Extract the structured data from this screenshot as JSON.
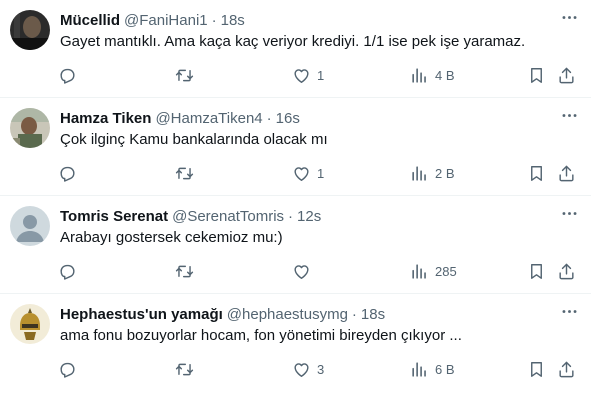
{
  "tweets": [
    {
      "name": "Mücellid",
      "handle": "@FaniHani1",
      "time": "18s",
      "text": "Gayet mantıklı. Ama kaça kaç veriyor krediyi. 1/1 ise pek işe yaramaz.",
      "likes": "1",
      "views": "4 B",
      "avatar_style": "dark-photo"
    },
    {
      "name": "Hamza Tiken",
      "handle": "@HamzaTiken4",
      "time": "16s",
      "text": "Çok ilginç Kamu bankalarında olacak mı",
      "likes": "1",
      "views": "2 B",
      "avatar_style": "outdoor-photo"
    },
    {
      "name": "Tomris Serenat",
      "handle": "@SerenatTomris",
      "time": "12s",
      "text": "Arabayı gostersek cekemioz mu:)",
      "likes": "",
      "views": "285",
      "avatar_style": "default-silhouette"
    },
    {
      "name": "Hephaestus'un yamağı",
      "handle": "@hephaestusymg",
      "time": "18s",
      "text": "ama fonu bozuyorlar hocam, fon yönetimi bireyden çıkıyor ...",
      "likes": "3",
      "views": "6 B",
      "avatar_style": "helmet-illustration"
    }
  ],
  "separator": "·",
  "icons": {
    "more": "more-horizontal-icon",
    "reply": "reply-icon",
    "retweet": "retweet-icon",
    "like": "like-heart-icon",
    "views": "views-bar-chart-icon",
    "bookmark": "bookmark-icon",
    "share": "share-icon"
  },
  "colors": {
    "text": "#0f1419",
    "secondary": "#536471",
    "divider": "#eff3f4"
  }
}
